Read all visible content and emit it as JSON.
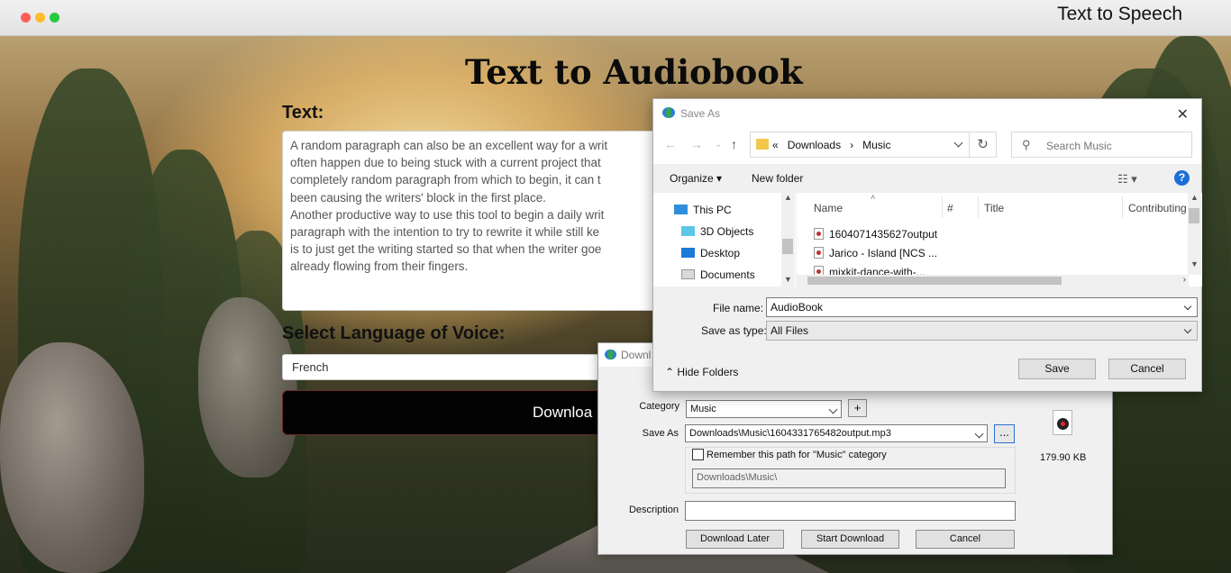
{
  "window": {
    "title": "Text to Speech"
  },
  "page": {
    "heading": "Text to Audiobook",
    "text_label": "Text:",
    "text_lines": [
      "A random paragraph can also be an excellent way for a writ",
      "often happen due to being stuck with a current project that",
      "completely random paragraph from which to begin, it can t",
      "been causing the writers' block in the first place.",
      "Another productive way to use this tool to begin a daily writ",
      "paragraph with the intention to try to rewrite it while still ke",
      "is to just get the writing started so that when the writer goe",
      "already flowing from their fingers."
    ],
    "language_label": "Select Language of Voice:",
    "language_value": "French",
    "download_button": "Downloa"
  },
  "download_dialog": {
    "title": "Downl",
    "category_label": "Category",
    "category_value": "Music",
    "add_button": "+",
    "save_as_label": "Save As",
    "save_as_value": "Downloads\\Music\\1604331765482output.mp3",
    "browse_button": "...",
    "remember_label": "Remember this path for \"Music\" category",
    "remember_checked": false,
    "path_value": "Downloads\\Music\\",
    "file_size": "179.90  KB",
    "description_label": "Description",
    "description_value": "",
    "download_later_button": "Download Later",
    "start_download_button": "Start Download",
    "cancel_button": "Cancel"
  },
  "save_dialog": {
    "title": "Save As",
    "breadcrumb_prefix": "«",
    "breadcrumb": [
      "Downloads",
      "Music"
    ],
    "breadcrumb_sep": "›",
    "search_placeholder": "Search Music",
    "organize_label": "Organize",
    "new_folder_label": "New folder",
    "help_label": "?",
    "tree_items": [
      "This PC",
      "3D Objects",
      "Desktop",
      "Documents"
    ],
    "columns": [
      "Name",
      "#",
      "Title",
      "Contributing"
    ],
    "files": [
      "1604071435627output",
      "Jarico - Island [NCS ...",
      "mixkit-dance-with-..."
    ],
    "file_name_label": "File name:",
    "file_name_value": "AudioBook",
    "save_type_label": "Save as type:",
    "save_type_value": "All Files",
    "hide_folders_label": "Hide Folders",
    "save_button": "Save",
    "cancel_button": "Cancel"
  },
  "colors": {
    "primary_button": "#030303",
    "help_icon": "#1c6fd6",
    "folder_icon": "#f2c84b"
  }
}
